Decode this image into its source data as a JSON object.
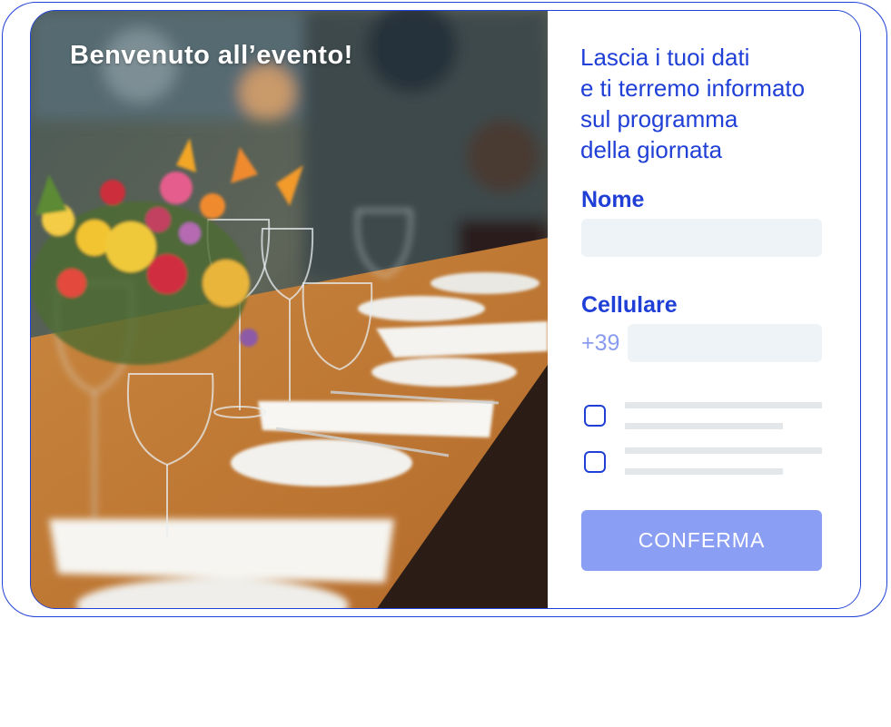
{
  "hero": {
    "welcome_text": "Benvenuto all’evento!",
    "image_subject": "banquet-table-with-flowers-and-glasses"
  },
  "form": {
    "intro_lines": [
      "Lascia i tuoi dati",
      "e ti terremo informato",
      "sul programma",
      "della giornata"
    ],
    "name_label": "Nome",
    "name_value": "",
    "phone_label": "Cellulare",
    "phone_prefix": "+39",
    "phone_value": "",
    "checkboxes": [
      {
        "checked": false
      },
      {
        "checked": false
      }
    ],
    "confirm_label": "CONFERMA"
  },
  "colors": {
    "accent": "#1f3fd6",
    "button": "#8a9ef3",
    "field_bg": "#eef3f7",
    "placeholder_line": "#e3e7ea"
  }
}
